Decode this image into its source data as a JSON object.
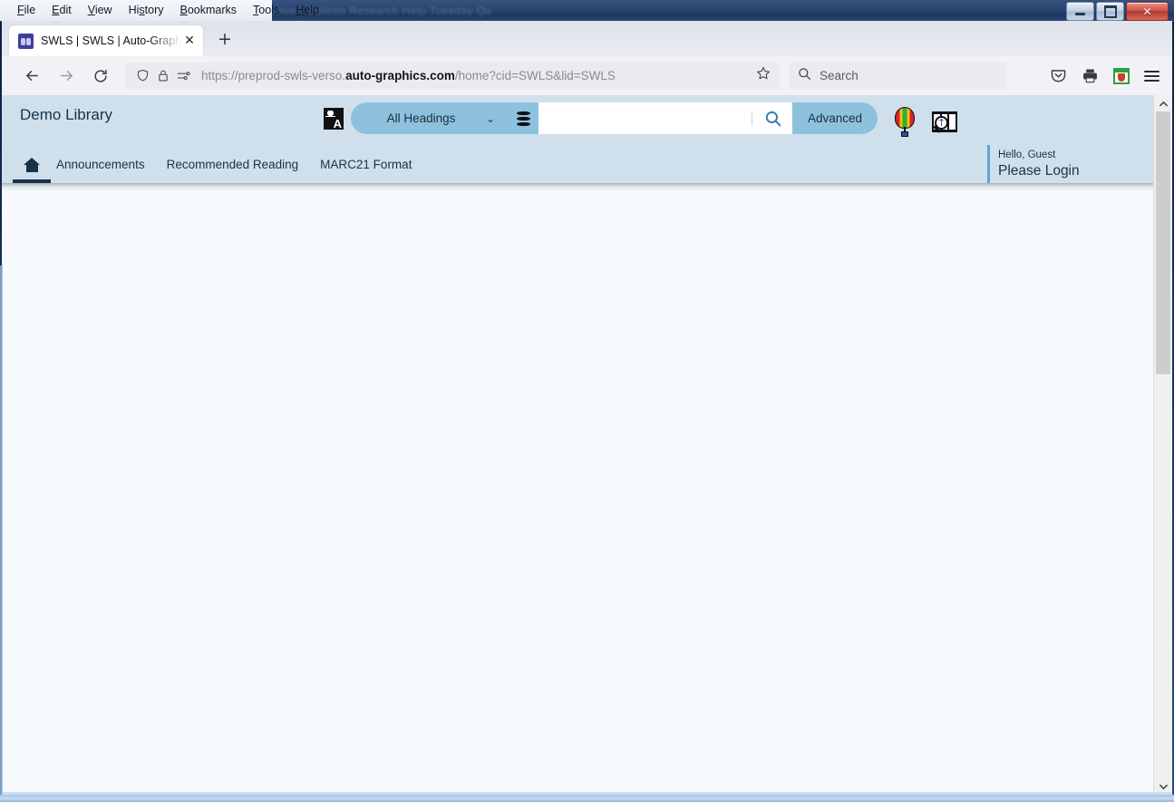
{
  "window": {
    "ghost_text": "Delivery   bulletin   Research   Help   Tuesday   Qu",
    "controls": {
      "minimize": "Minimize",
      "maximize": "Maximize",
      "close": "✕"
    }
  },
  "menubar": {
    "items": [
      {
        "label": "File",
        "accel": "F",
        "rest": "ile"
      },
      {
        "label": "Edit",
        "accel": "E",
        "rest": "dit"
      },
      {
        "label": "View",
        "accel": "V",
        "rest": "iew"
      },
      {
        "label": "History",
        "accel": "Hi",
        "rest": "story"
      },
      {
        "label": "Bookmarks",
        "accel": "B",
        "rest": "ookmarks"
      },
      {
        "label": "Tools",
        "accel": "T",
        "rest": "ools"
      },
      {
        "label": "Help",
        "accel": "H",
        "rest": "elp"
      }
    ]
  },
  "browser": {
    "tab": {
      "title": "SWLS | SWLS | Auto-Graphics In",
      "favicon_name": "swls-favicon",
      "close_glyph": "✕"
    },
    "new_tab_glyph": "+",
    "url": {
      "prefix": "https://preprod-swls-verso.",
      "domain": "auto-graphics.com",
      "suffix": "/home?cid=SWLS&lid=SWLS",
      "full": "https://preprod-swls-verso.auto-graphics.com/home?cid=SWLS&lid=SWLS"
    },
    "search": {
      "placeholder": "Search"
    },
    "toolbar_icons": [
      "pocket-icon",
      "printer-icon",
      "extension-icon",
      "hamburger-menu-icon"
    ]
  },
  "page": {
    "library_title": "Demo Library",
    "search": {
      "scope_label": "All Headings",
      "query_value": "",
      "advanced_label": "Advanced",
      "chevron": "⌄"
    },
    "right_icons": [
      "hot-air-balloon-icon",
      "filmstrip-search-icon",
      "list-view-icon"
    ],
    "nav_tabs": [
      "Announcements",
      "Recommended Reading",
      "MARC21 Format"
    ],
    "user": {
      "greeting": "Hello, Guest",
      "login_label": "Please Login"
    },
    "scroll": {
      "up_glyph": "▲",
      "down_glyph": "▼"
    }
  },
  "colors": {
    "header_bg": "#cfe0ec",
    "accent_blue": "#8ec1de",
    "user_accent": "#5aa8d6",
    "page_bg": "#f7fbfd",
    "title_text": "#17324a"
  }
}
